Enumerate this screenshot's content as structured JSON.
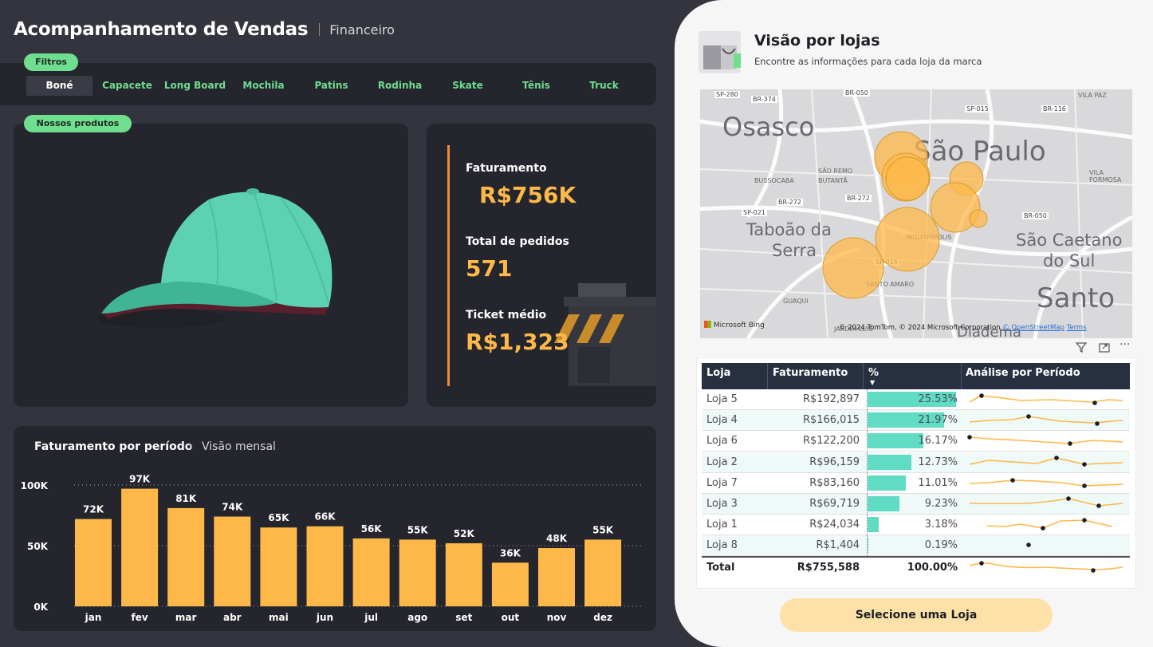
{
  "header": {
    "title": "Acompanhamento de Vendas",
    "subtitle": "Financeiro"
  },
  "filters": {
    "label": "Filtros",
    "items": [
      "Boné",
      "Capacete",
      "Long Board",
      "Mochila",
      "Patins",
      "Rodinha",
      "Skate",
      "Tênis",
      "Truck"
    ],
    "selected": "Boné"
  },
  "products": {
    "label": "Nossos produtos"
  },
  "kpis": {
    "revenue_label": "Faturamento",
    "revenue_value": "R$756K",
    "orders_label": "Total de pedidos",
    "orders_value": "571",
    "ticket_label": "Ticket médio",
    "ticket_value": "R$1,323"
  },
  "chart": {
    "title": "Faturamento por período",
    "subtitle": "Visão mensal"
  },
  "chart_data": {
    "type": "bar",
    "categories": [
      "jan",
      "fev",
      "mar",
      "abr",
      "mai",
      "jun",
      "jul",
      "ago",
      "set",
      "out",
      "nov",
      "dez"
    ],
    "values": [
      72,
      97,
      81,
      74,
      65,
      66,
      56,
      55,
      52,
      36,
      48,
      55
    ],
    "data_labels": [
      "72K",
      "97K",
      "81K",
      "74K",
      "65K",
      "66K",
      "56K",
      "55K",
      "52K",
      "36K",
      "48K",
      "55K"
    ],
    "y_ticks": [
      "0K",
      "50K",
      "100K"
    ],
    "ylim": [
      0,
      100
    ],
    "grid": true,
    "color": "#fdb849"
  },
  "stores_panel": {
    "title": "Visão por lojas",
    "subtitle": "Encontre as informações para cada loja da marca",
    "map": {
      "labels": [
        "Osasco",
        "São Paulo",
        "Taboão da",
        "Serra",
        "São Caetano",
        "do Sul",
        "Santo",
        "Diadema"
      ],
      "small_labels": [
        "SÃO REMO",
        "BUTANTÃ",
        "BUSSOCABA",
        "INDIANÓPOLIS",
        "SANTO AMARO",
        "GUAQUI",
        "VILA PAZ",
        "VILA FORMOSA",
        "JARDIM LUIS"
      ],
      "roads": [
        "SP-280",
        "BR-374",
        "BR-050",
        "SP-015",
        "BR-116",
        "BR-272",
        "BR-272",
        "SP-021",
        "BR-050",
        "SP-015"
      ],
      "attribution": "© 2024 TomTom, © 2024 Microsoft Corporation",
      "osm": "© OpenStreetMap",
      "terms": "Terms",
      "provider": "Microsoft Bing"
    },
    "table": {
      "headers": [
        "Loja",
        "Faturamento",
        "%",
        "Análise por Período"
      ],
      "rows": [
        {
          "loja": "Loja 5",
          "fat": "R$192,897",
          "pct": "25.53%",
          "p": 25.53
        },
        {
          "loja": "Loja 4",
          "fat": "R$166,015",
          "pct": "21.97%",
          "p": 21.97
        },
        {
          "loja": "Loja 6",
          "fat": "R$122,200",
          "pct": "16.17%",
          "p": 16.17
        },
        {
          "loja": "Loja 2",
          "fat": "R$96,159",
          "pct": "12.73%",
          "p": 12.73
        },
        {
          "loja": "Loja 7",
          "fat": "R$83,160",
          "pct": "11.01%",
          "p": 11.01
        },
        {
          "loja": "Loja 3",
          "fat": "R$69,719",
          "pct": "9.23%",
          "p": 9.23
        },
        {
          "loja": "Loja 1",
          "fat": "R$24,034",
          "pct": "3.18%",
          "p": 3.18
        },
        {
          "loja": "Loja 8",
          "fat": "R$1,404",
          "pct": "0.19%",
          "p": 0.19
        }
      ],
      "total": {
        "loja": "Total",
        "fat": "R$755,588",
        "pct": "100.00%"
      }
    },
    "button": "Selecione uma Loja"
  }
}
